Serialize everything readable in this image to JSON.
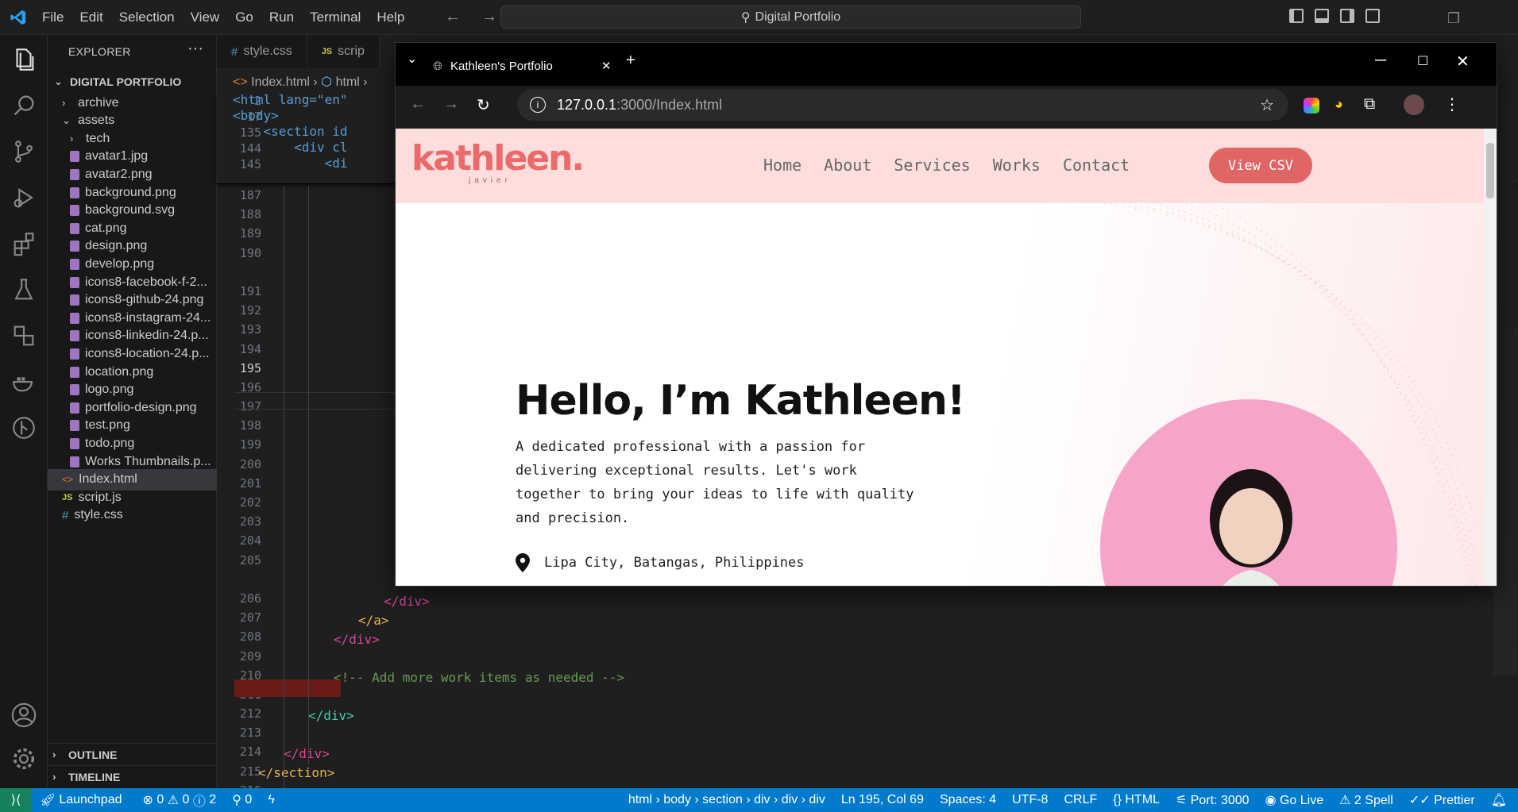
{
  "menu": [
    "File",
    "Edit",
    "Selection",
    "View",
    "Go",
    "Run",
    "Terminal",
    "Help"
  ],
  "command_center": "Digital Portfolio",
  "explorer": {
    "title": "EXPLORER",
    "root": "DIGITAL PORTFOLIO",
    "items": [
      {
        "label": "archive",
        "kind": "folder",
        "indent": 1,
        "open": false
      },
      {
        "label": "assets",
        "kind": "folder",
        "indent": 1,
        "open": true
      },
      {
        "label": "tech",
        "kind": "folder",
        "indent": 2,
        "open": false
      },
      {
        "label": "avatar1.jpg",
        "kind": "img",
        "indent": 2
      },
      {
        "label": "avatar2.png",
        "kind": "img",
        "indent": 2
      },
      {
        "label": "background.png",
        "kind": "img",
        "indent": 2
      },
      {
        "label": "background.svg",
        "kind": "img",
        "indent": 2
      },
      {
        "label": "cat.png",
        "kind": "img",
        "indent": 2
      },
      {
        "label": "design.png",
        "kind": "img",
        "indent": 2
      },
      {
        "label": "develop.png",
        "kind": "img",
        "indent": 2
      },
      {
        "label": "icons8-facebook-f-2...",
        "kind": "img",
        "indent": 2
      },
      {
        "label": "icons8-github-24.png",
        "kind": "img",
        "indent": 2
      },
      {
        "label": "icons8-instagram-24...",
        "kind": "img",
        "indent": 2
      },
      {
        "label": "icons8-linkedin-24.p...",
        "kind": "img",
        "indent": 2
      },
      {
        "label": "icons8-location-24.p...",
        "kind": "img",
        "indent": 2
      },
      {
        "label": "location.png",
        "kind": "img",
        "indent": 2
      },
      {
        "label": "logo.png",
        "kind": "img",
        "indent": 2
      },
      {
        "label": "portfolio-design.png",
        "kind": "img",
        "indent": 2
      },
      {
        "label": "test.png",
        "kind": "img",
        "indent": 2
      },
      {
        "label": "todo.png",
        "kind": "img",
        "indent": 2
      },
      {
        "label": "Works Thumbnails.p...",
        "kind": "img",
        "indent": 2
      },
      {
        "label": "Index.html",
        "kind": "html",
        "indent": 1,
        "selected": true
      },
      {
        "label": "script.js",
        "kind": "js",
        "indent": 1
      },
      {
        "label": "style.css",
        "kind": "css",
        "indent": 1
      }
    ],
    "outline": "OUTLINE",
    "timeline": "TIMELINE"
  },
  "editor_tabs": {
    "tab1": "style.css",
    "tab2": "scrip"
  },
  "breadcrumb": {
    "file": "Index.html",
    "node": "html"
  },
  "sticky_lines": [
    {
      "num": "2",
      "code": "<html lang=\"en\""
    },
    {
      "num": "17",
      "code": "<body>"
    },
    {
      "num": "135",
      "code": "    <section id"
    },
    {
      "num": "144",
      "code": "        <div cl"
    },
    {
      "num": "145",
      "code": "            <di"
    }
  ],
  "line_numbers_top": [
    "187",
    "188",
    "189",
    "190",
    "",
    "191",
    "192",
    "193",
    "194",
    "195",
    "196",
    "197",
    "198",
    "199",
    "200",
    "201",
    "202",
    "203",
    "204",
    "205",
    "",
    "206",
    "207",
    "208",
    "209",
    "210",
    "211",
    "212",
    "213",
    "214",
    "215",
    "216"
  ],
  "code_lines": {
    "l206": "</div>",
    "l207": "</a>",
    "l208": "</div>",
    "l210": "<!-- Add more work items as needed -->",
    "l212": "</div>",
    "l214": "</div>",
    "l215": "</section>"
  },
  "browser": {
    "tab_title": "Kathleen's Portfolio",
    "url_host": "127.0.0.1",
    "url_rest": ":3000/Index.html"
  },
  "site": {
    "logo": "kathleen.",
    "logo_sub": "javier",
    "nav": [
      "Home",
      "About",
      "Services",
      "Works",
      "Contact"
    ],
    "cta": "View CSV",
    "heading": "Hello, I’m Kathleen!",
    "intro": "A dedicated professional with a passion for delivering exceptional results. Let's work together to bring your ideas to life with quality and precision.",
    "location": "Lipa City, Batangas, Philippines"
  },
  "status": {
    "launchpad": "Launchpad",
    "errors": "0",
    "warnings": "0",
    "infos": "2",
    "ports": "0",
    "path": "html › body › section › div › div › div",
    "cursor": "Ln 195, Col 69",
    "spaces": "Spaces: 4",
    "encoding": "UTF-8",
    "eol": "CRLF",
    "language": "HTML",
    "port": "Port: 3000",
    "golive": "Go Live",
    "spell": "2 Spell",
    "prettier": "Prettier"
  },
  "colors": {
    "accent": "#007acc",
    "brand": "#e06666",
    "nav_bg": "#fddedd"
  }
}
